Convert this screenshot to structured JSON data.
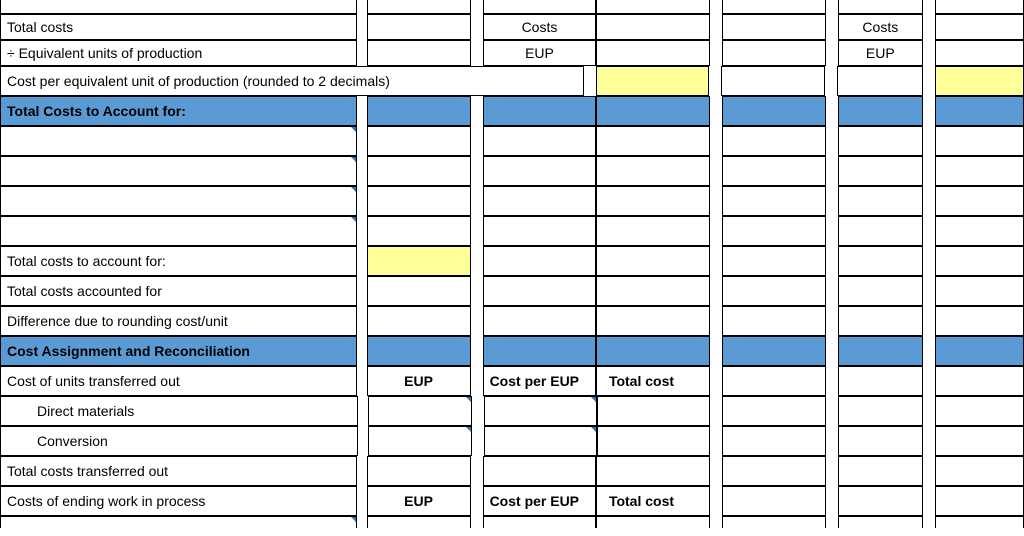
{
  "rows": {
    "header_partial": {
      "a": ""
    },
    "total_costs": {
      "a": "Total costs",
      "c": "Costs",
      "f": "Costs"
    },
    "eup": {
      "a": "÷ Equivalent units of production",
      "c": "EUP",
      "f": "EUP"
    },
    "cost_per_eup": {
      "a": "Cost per equivalent unit of production (rounded to 2 decimals)"
    },
    "section_total_costs": {
      "a": "Total Costs to Account for:"
    },
    "total_to_account": {
      "a": "Total costs to account for:"
    },
    "total_accounted": {
      "a": "Total costs accounted for"
    },
    "rounding": {
      "a": "Difference due to rounding cost/unit"
    },
    "section_assignment": {
      "a": "Cost Assignment and Reconciliation"
    },
    "transferred_out": {
      "a": "Cost of units transferred out",
      "b": "EUP",
      "c": "Cost per EUP",
      "d": "Total cost"
    },
    "dm": {
      "a": "Direct materials"
    },
    "conv": {
      "a": "Conversion"
    },
    "tot_trans": {
      "a": "Total costs transferred out"
    },
    "ending_wip": {
      "a": "Costs of ending work in process",
      "b": "EUP",
      "c": "Cost per EUP",
      "d": "Total cost"
    }
  }
}
